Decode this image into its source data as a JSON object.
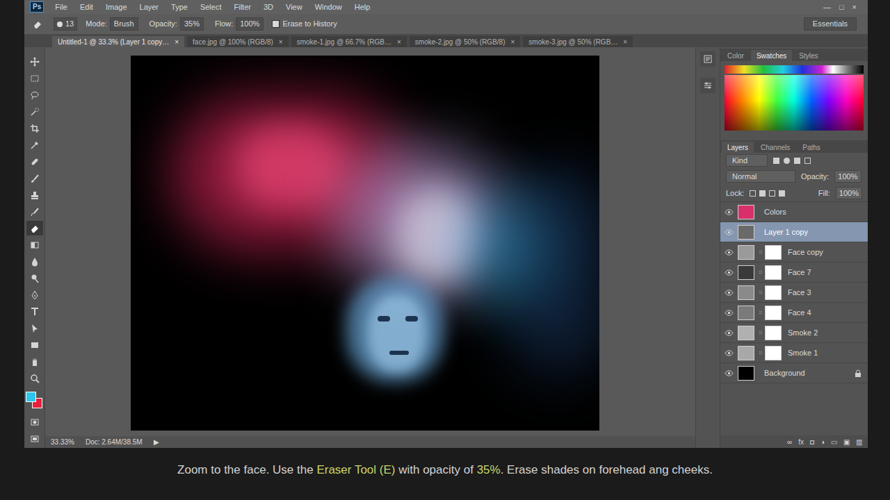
{
  "app_logo": "Ps",
  "menu": [
    "File",
    "Edit",
    "Image",
    "Layer",
    "Type",
    "Select",
    "Filter",
    "3D",
    "View",
    "Window",
    "Help"
  ],
  "window_controls": [
    "—",
    "□",
    "×"
  ],
  "options_bar": {
    "brush_size": "13",
    "fields": [
      {
        "label": "Mode:",
        "value": "Brush"
      },
      {
        "label": "Opacity:",
        "value": "35%"
      },
      {
        "label": "Flow:",
        "value": "100%"
      }
    ],
    "checkbox": {
      "label": "Erase to History",
      "checked": false
    },
    "workspace": "Essentials"
  },
  "doc_tabs": [
    {
      "label": "Untitled-1 @ 33.3% (Layer 1 copy…",
      "selected": true
    },
    {
      "label": "face.jpg @ 100% (RGB/8)",
      "selected": false
    },
    {
      "label": "smoke-1.jpg @ 66.7% (RGB…",
      "selected": false
    },
    {
      "label": "smoke-2.jpg @ 50% (RGB/8)",
      "selected": false
    },
    {
      "label": "smoke-3.jpg @ 50% (RGB…",
      "selected": false
    }
  ],
  "tab_close": "×",
  "tools": [
    {
      "kind": "move",
      "selected": false
    },
    {
      "kind": "marquee",
      "selected": false
    },
    {
      "kind": "lasso",
      "selected": false
    },
    {
      "kind": "quick-select",
      "selected": false
    },
    {
      "kind": "crop",
      "selected": false
    },
    {
      "kind": "eyedropper",
      "selected": false
    },
    {
      "kind": "heal",
      "selected": false
    },
    {
      "kind": "brush",
      "selected": false
    },
    {
      "kind": "stamp",
      "selected": false
    },
    {
      "kind": "history",
      "selected": false
    },
    {
      "kind": "eraser",
      "selected": true
    },
    {
      "kind": "gradient",
      "selected": false
    },
    {
      "kind": "blur",
      "selected": false
    },
    {
      "kind": "dodge",
      "selected": false
    },
    {
      "kind": "pen",
      "selected": false
    },
    {
      "kind": "type",
      "selected": false
    },
    {
      "kind": "path-select",
      "selected": false
    },
    {
      "kind": "shape",
      "selected": false
    },
    {
      "kind": "hand",
      "selected": false
    },
    {
      "kind": "zoom",
      "selected": false
    }
  ],
  "colors": {
    "foreground": "#2ec6ec",
    "background": "#e8203c"
  },
  "status_bar": {
    "zoom": "33.33%",
    "doc": "Doc: 2.64M/38.5M",
    "arrow": "▶"
  },
  "color_panel": {
    "tabs": [
      {
        "label": "Color",
        "selected": false
      },
      {
        "label": "Swatches",
        "selected": true
      },
      {
        "label": "Styles",
        "selected": false
      }
    ]
  },
  "layers_panel": {
    "tabs": [
      {
        "label": "Layers",
        "selected": true
      },
      {
        "label": "Channels",
        "selected": false
      },
      {
        "label": "Paths",
        "selected": false
      }
    ],
    "filter": "Kind",
    "blend_mode": "Normal",
    "opacity_label": "Opacity:",
    "opacity": "100%",
    "lock_label": "Lock:",
    "fill_label": "Fill:",
    "fill": "100%",
    "layers": [
      {
        "name": "Colors",
        "visible": true,
        "selected": false,
        "mask": false,
        "locked": false,
        "color": "#d8306a"
      },
      {
        "name": "Layer 1 copy",
        "visible": true,
        "selected": true,
        "mask": false,
        "locked": false,
        "color": "#6a6a6a"
      },
      {
        "name": "Face copy",
        "visible": true,
        "selected": false,
        "mask": true,
        "locked": false,
        "color": "#9a9a9a"
      },
      {
        "name": "Face 7",
        "visible": true,
        "selected": false,
        "mask": true,
        "locked": false,
        "color": "#3a3a3a"
      },
      {
        "name": "Face 3",
        "visible": true,
        "selected": false,
        "mask": true,
        "locked": false,
        "color": "#8a8a8a"
      },
      {
        "name": "Face 4",
        "visible": true,
        "selected": false,
        "mask": true,
        "locked": false,
        "color": "#7a7a7a"
      },
      {
        "name": "Smoke 2",
        "visible": true,
        "selected": false,
        "mask": true,
        "locked": false,
        "color": "#b0b0b0"
      },
      {
        "name": "Smoke 1",
        "visible": true,
        "selected": false,
        "mask": true,
        "locked": false,
        "color": "#a8a8a8"
      },
      {
        "name": "Background",
        "visible": true,
        "selected": false,
        "mask": false,
        "locked": true,
        "color": "#000000"
      }
    ],
    "actions": [
      "∞",
      "fx",
      "◘",
      "◑",
      "▭",
      "▣",
      "▥"
    ]
  },
  "caption": [
    {
      "text": "Zoom to the face. Use the ",
      "highlight": false
    },
    {
      "text": "Eraser Tool (E)",
      "highlight": true
    },
    {
      "text": " with opacity of ",
      "highlight": false
    },
    {
      "text": "35%",
      "highlight": true
    },
    {
      "text": ". Erase shades on forehead ang cheeks.",
      "highlight": false
    }
  ]
}
